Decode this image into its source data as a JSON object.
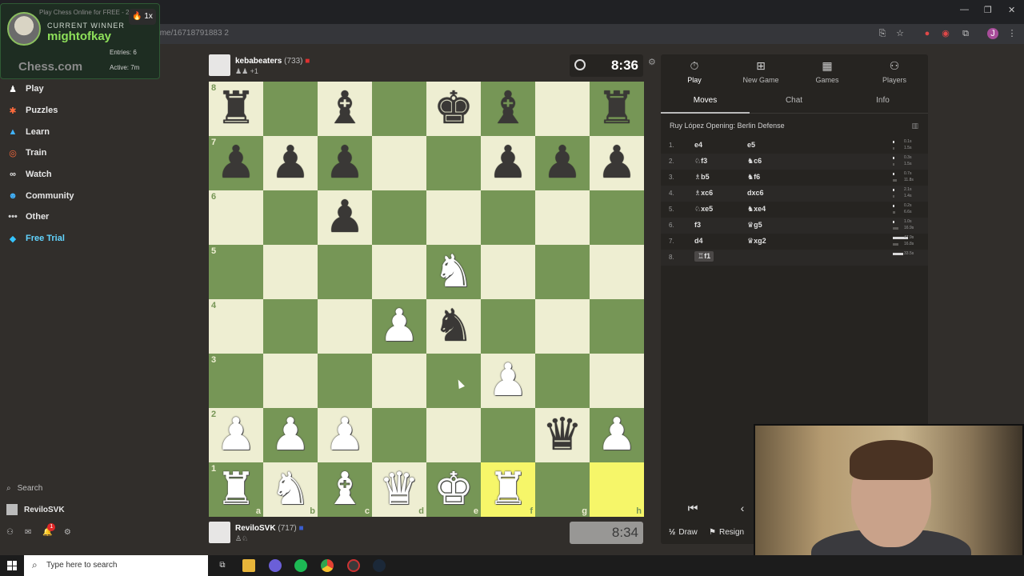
{
  "browser": {
    "url": "chess.com/game/16718791883 2",
    "tab_title": "Play Chess Online for FREE - 2"
  },
  "overlay": {
    "promo": "Play Chess Online for FREE - 2",
    "streak": "🔥 1x",
    "current_winner_label": "CURRENT WINNER",
    "winner_name": "mightofkay",
    "logo": "Chess.com",
    "entries": "Entries: 6",
    "active": "Active: 7m"
  },
  "nav": {
    "items": [
      {
        "label": "Play",
        "icon": "♟",
        "color": "#ffffff"
      },
      {
        "label": "Puzzles",
        "icon": "🧩",
        "color": "#ff6b3d"
      },
      {
        "label": "Learn",
        "icon": "🎓",
        "color": "#41b3ff"
      },
      {
        "label": "Train",
        "icon": "🎯",
        "color": "#ff6b3d"
      },
      {
        "label": "Watch",
        "icon": "👀",
        "color": "#e5e5e5"
      },
      {
        "label": "Community",
        "icon": "👥",
        "color": "#41b3ff"
      },
      {
        "label": "Other",
        "icon": "•••",
        "color": "#d0d0d0"
      },
      {
        "label": "Free Trial",
        "icon": "💎",
        "color": "#35c4ff"
      }
    ],
    "search_label": "Search",
    "user_label": "ReviloSVK",
    "notification_count": "1"
  },
  "game": {
    "top_player": {
      "name": "kebabeaters",
      "rating": "(733)",
      "sub": "♟♟ +1"
    },
    "bottom_player": {
      "name": "ReviloSVK",
      "rating": "(717)",
      "sub": "♙♘"
    },
    "top_clock": "8:36",
    "bottom_clock": "8:34",
    "rank_labels": [
      "8",
      "7",
      "6",
      "5",
      "4",
      "3",
      "2",
      "1"
    ],
    "file_labels": [
      "a",
      "b",
      "c",
      "d",
      "e",
      "f",
      "g",
      "h"
    ],
    "position": [
      [
        "br",
        "",
        "bb",
        "",
        "bk",
        "bb",
        "",
        "br"
      ],
      [
        "bp",
        "bp",
        "bp",
        "",
        "",
        "bp",
        "bp",
        "bp"
      ],
      [
        "",
        "",
        "bp",
        "",
        "",
        "",
        "",
        ""
      ],
      [
        "",
        "",
        "",
        "",
        "wn",
        "",
        "",
        ""
      ],
      [
        "",
        "",
        "",
        "wp",
        "bn",
        "",
        "",
        ""
      ],
      [
        "",
        "",
        "",
        "",
        "",
        "wp",
        "",
        ""
      ],
      [
        "wp",
        "wp",
        "wp",
        "",
        "",
        "",
        "bq",
        "wp"
      ],
      [
        "wr",
        "wn",
        "wb",
        "wq",
        "wk",
        "wr",
        "",
        ""
      ]
    ],
    "highlight": [
      "f1",
      "h1"
    ]
  },
  "panel": {
    "tabs": [
      {
        "label": "Play",
        "icon": "⏱"
      },
      {
        "label": "New Game",
        "icon": "+"
      },
      {
        "label": "Games",
        "icon": "▦"
      },
      {
        "label": "Players",
        "icon": "👥"
      }
    ],
    "subtabs": [
      "Moves",
      "Chat",
      "Info"
    ],
    "opening": "Ruy López Opening: Berlin Defense",
    "moves": [
      {
        "n": "1.",
        "w": "e4",
        "b": "e5",
        "t": [
          "0.1s",
          "1.5s"
        ]
      },
      {
        "n": "2.",
        "w": "♘f3",
        "b": "♞c6",
        "t": [
          "0.3s",
          "1.5s"
        ]
      },
      {
        "n": "3.",
        "w": "♗b5",
        "b": "♞f6",
        "t": [
          "0.7s",
          "11.8s"
        ]
      },
      {
        "n": "4.",
        "w": "♗xc6",
        "b": "dxc6",
        "t": [
          "2.1s",
          "1.4s"
        ]
      },
      {
        "n": "5.",
        "w": "♘xe5",
        "b": "♞xe4",
        "t": [
          "0.2s",
          "6.6s"
        ]
      },
      {
        "n": "6.",
        "w": "f3",
        "b": "♛g5",
        "t": [
          "1.0s",
          "16.9s"
        ]
      },
      {
        "n": "7.",
        "w": "d4",
        "b": "♛xg2",
        "t": [
          "47.9s",
          "16.8s"
        ]
      },
      {
        "n": "8.",
        "w": "♖f1",
        "b": "",
        "t": [
          "33.5s",
          ""
        ]
      }
    ],
    "nav_first": "⏮",
    "nav_prev": "‹",
    "draw_label": "Draw",
    "resign_label": "Resign"
  },
  "taskbar": {
    "search_placeholder": "Type here to search"
  }
}
